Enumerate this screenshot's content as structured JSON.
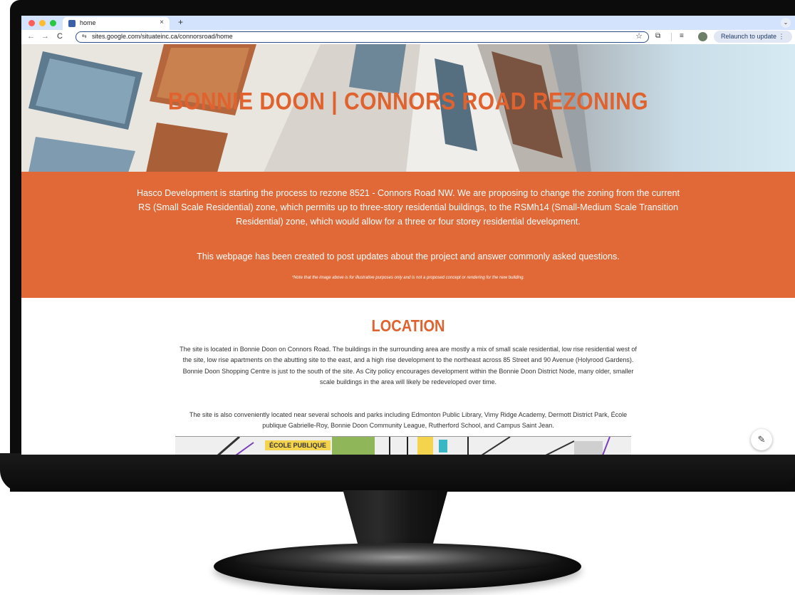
{
  "browser": {
    "tab_title": "home",
    "tab_close": "×",
    "new_tab": "+",
    "tab_menu": "⌄",
    "back": "←",
    "forward": "→",
    "reload": "C",
    "site_info": "⇆",
    "url": "sites.google.com/situateinc.ca/connorsroad/home",
    "star": "☆",
    "relaunch_label": "Relaunch to update ⋮"
  },
  "hero": {
    "title": "BONNIE DOON | CONNORS ROAD REZONING"
  },
  "intro": {
    "paragraph1": "Hasco Development is starting the process to rezone 8521 - Connors Road NW. We are proposing to change the zoning from the current RS (Small Scale Residential) zone, which permits up to three-story residential buildings, to the RSMh14 (Small-Medium Scale Transition Residential) zone, which would allow for a three or four storey residential development.",
    "paragraph2": "This webpage has been created to post updates about the project and answer commonly asked questions.",
    "note": "*Note that the image above is for illustrative purposes only and is not a proposed concept or rendering for the new building."
  },
  "location": {
    "title": "LOCATION",
    "paragraph1": "The site is located in Bonnie Doon on Connors Road. The buildings in the surrounding area are mostly a mix of small scale residential, low rise residential west of the site, low rise apartments on the abutting site to the east, and a high rise development to the northeast across 85 Street and 90 Avenue (Holyrood Gardens). Bonnie Doon Shopping Centre is just to the south of the site. As City policy encourages development within the Bonnie Doon District Node, many older, smaller scale buildings in the area will likely be redeveloped over time.",
    "paragraph2": "The site is also conveniently located near several schools and parks including Edmonton Public Library, Vimy Ridge Academy, Dermott District Park, École publique Gabrielle-Roy, Bonnie Doon Community League, Rutherford School, and Campus Saint Jean.",
    "map_label": "ÉCOLE PUBLIQUE"
  },
  "edit_button_icon": "pencil-icon",
  "colors": {
    "accent": "#e06937",
    "title_orange": "#e0632f",
    "tab_bar": "#d3e3fd"
  }
}
